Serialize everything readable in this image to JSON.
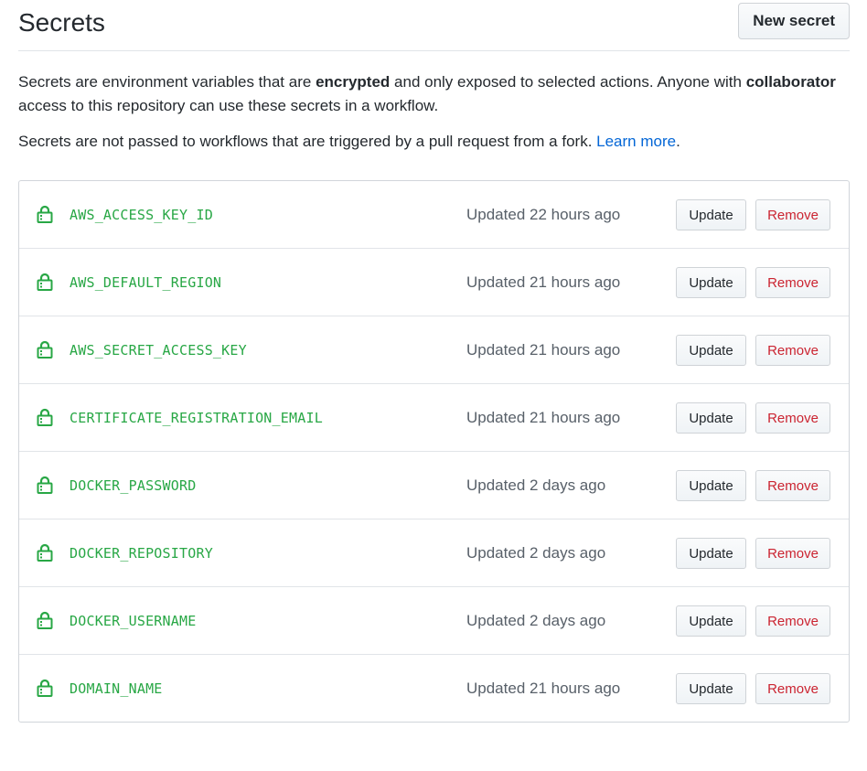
{
  "header": {
    "title": "Secrets",
    "new_secret_label": "New secret"
  },
  "description": {
    "line1_pre": "Secrets are environment variables that are ",
    "line1_bold1": "encrypted",
    "line1_mid": " and only exposed to selected actions. Anyone with ",
    "line1_bold2": "collaborator",
    "line1_post": " access to this repository can use these secrets in a workflow.",
    "line2_pre": "Secrets are not passed to workflows that are triggered by a pull request from a fork. ",
    "line2_link": "Learn more",
    "line2_post": "."
  },
  "colors": {
    "secret_name": "#28a745",
    "link": "#0366d6",
    "remove": "#cb2431"
  },
  "icons": {
    "secret": "lock-icon"
  },
  "secrets": [
    {
      "name": "AWS_ACCESS_KEY_ID",
      "updated": "Updated 22 hours ago",
      "update_label": "Update",
      "remove_label": "Remove"
    },
    {
      "name": "AWS_DEFAULT_REGION",
      "updated": "Updated 21 hours ago",
      "update_label": "Update",
      "remove_label": "Remove"
    },
    {
      "name": "AWS_SECRET_ACCESS_KEY",
      "updated": "Updated 21 hours ago",
      "update_label": "Update",
      "remove_label": "Remove"
    },
    {
      "name": "CERTIFICATE_REGISTRATION_EMAIL",
      "updated": "Updated 21 hours ago",
      "update_label": "Update",
      "remove_label": "Remove"
    },
    {
      "name": "DOCKER_PASSWORD",
      "updated": "Updated 2 days ago",
      "update_label": "Update",
      "remove_label": "Remove"
    },
    {
      "name": "DOCKER_REPOSITORY",
      "updated": "Updated 2 days ago",
      "update_label": "Update",
      "remove_label": "Remove"
    },
    {
      "name": "DOCKER_USERNAME",
      "updated": "Updated 2 days ago",
      "update_label": "Update",
      "remove_label": "Remove"
    },
    {
      "name": "DOMAIN_NAME",
      "updated": "Updated 21 hours ago",
      "update_label": "Update",
      "remove_label": "Remove"
    }
  ]
}
